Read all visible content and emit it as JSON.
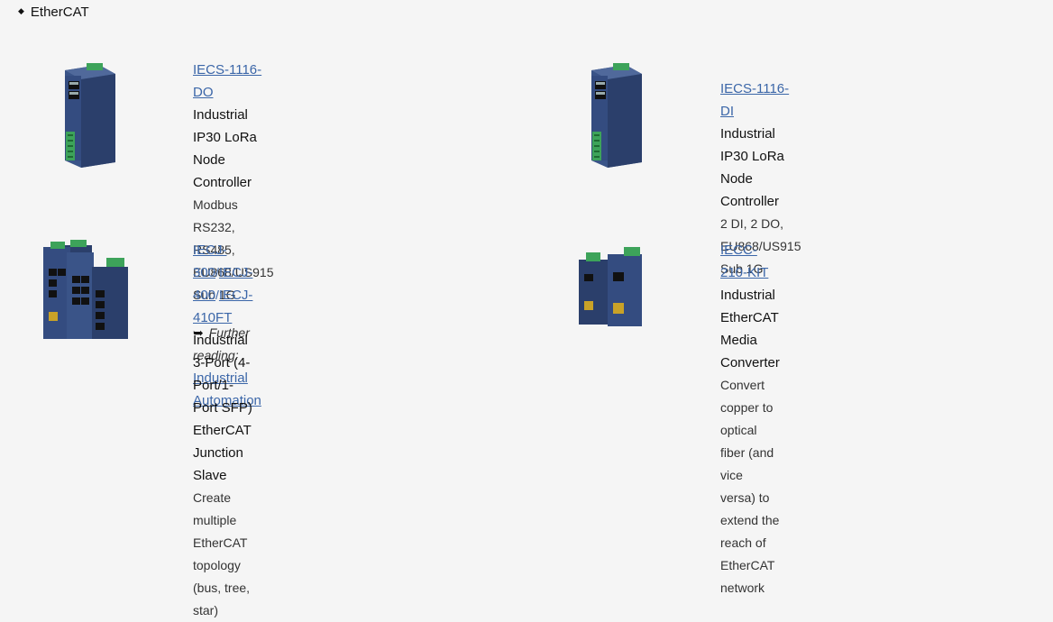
{
  "section": {
    "title": "EtherCAT"
  },
  "products": [
    {
      "links": [
        "IECS-1116-DO"
      ],
      "name": "Industrial IP30 LoRa Node Controller",
      "desc": "Modbus RS232, RS485, EU868/US915 Sub 1G",
      "further_label": "Further reading:",
      "further_link": "Industrial Automation"
    },
    {
      "links": [
        "IECS-1116-DI"
      ],
      "name": "Industrial IP30 LoRa Node Controller",
      "desc": "2 DI, 2 DO, EU868/US915 Sub 1G"
    },
    {
      "links": [
        "IECJ-300",
        "IECJ-400",
        "IECJ-410FT"
      ],
      "link_sep": "/",
      "name_line1": "Industrial 3-Port (4-Port/1-Port SFP) EtherCAT",
      "name_line2": "Junction Slave",
      "desc": "Create multiple EtherCAT topology (bus, tree, star)"
    },
    {
      "links": [
        "IECC-210-KIT"
      ],
      "name": "Industrial EtherCAT Media Converter",
      "desc_line1": "Convert copper to optical fiber (and vice versa) to",
      "desc_line2": "extend the reach of EtherCAT network"
    }
  ],
  "colors": {
    "link": "#3b66a8",
    "device_body": "#2b3f6b",
    "terminal": "#3da35a"
  }
}
